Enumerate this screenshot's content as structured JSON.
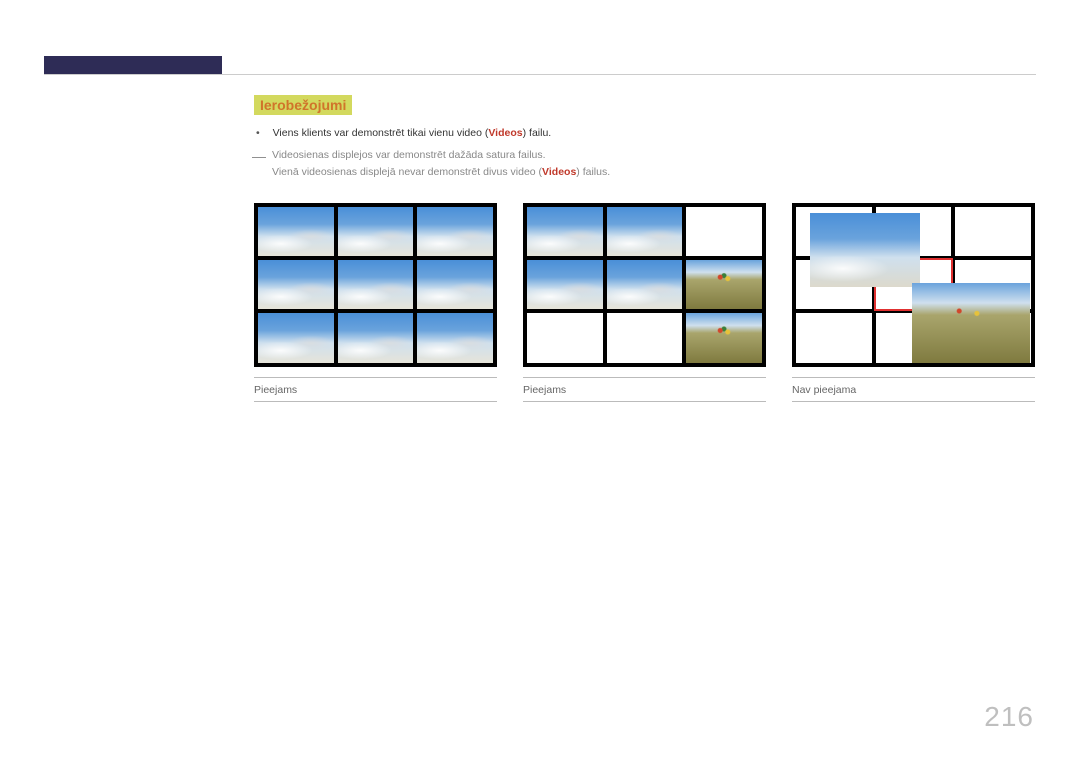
{
  "section_title": "Ierobežojumi",
  "bullet_1_pre": "Viens klients var demonstrēt tikai vienu video (",
  "bullet_1_bold": "Videos",
  "bullet_1_post": ") failu.",
  "note_line_1": "Videosienas displejos var demonstrēt dažāda satura failus.",
  "note_line_2_pre": "Vienā videosienas displejā nevar demonstrēt divus video (",
  "note_line_2_bold": "Videos",
  "note_line_2_post": ") failus.",
  "captions": [
    "Pieejams",
    "Pieejams",
    "Nav pieejama"
  ],
  "page_number": "216"
}
